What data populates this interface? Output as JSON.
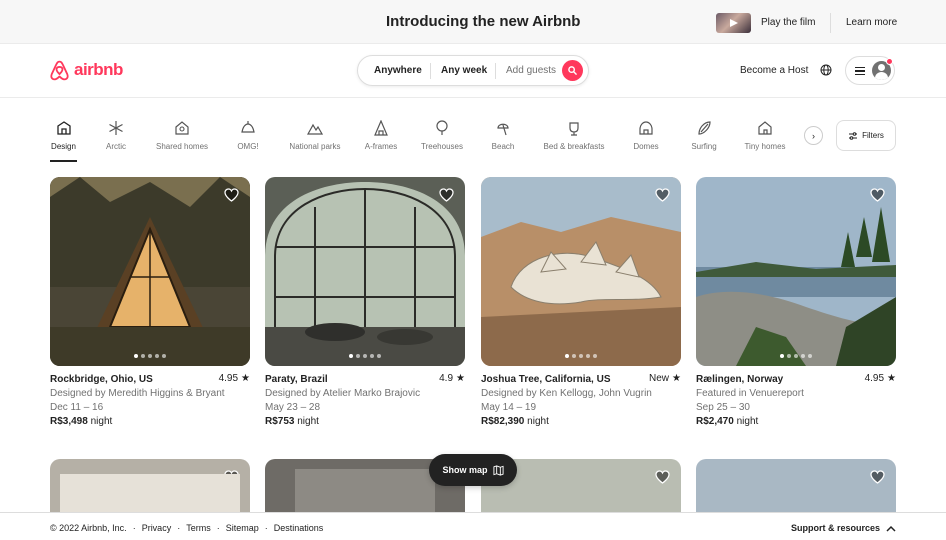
{
  "banner": {
    "title": "Introducing the new Airbnb",
    "play_label": "Play the film",
    "learn_label": "Learn more"
  },
  "header": {
    "logo_text": "airbnb",
    "brand_color": "#ff385c",
    "search": {
      "anywhere": "Anywhere",
      "any_week": "Any week",
      "add_guests": "Add guests"
    },
    "become_host": "Become a Host"
  },
  "categories": [
    {
      "label": "Design",
      "icon": "design-icon",
      "active": true
    },
    {
      "label": "Arctic",
      "icon": "arctic-icon"
    },
    {
      "label": "Shared homes",
      "icon": "shared-homes-icon"
    },
    {
      "label": "OMG!",
      "icon": "omg-icon"
    },
    {
      "label": "National parks",
      "icon": "national-parks-icon"
    },
    {
      "label": "A-frames",
      "icon": "a-frames-icon"
    },
    {
      "label": "Treehouses",
      "icon": "treehouses-icon"
    },
    {
      "label": "Beach",
      "icon": "beach-icon"
    },
    {
      "label": "Bed & breakfasts",
      "icon": "bed-breakfasts-icon"
    },
    {
      "label": "Domes",
      "icon": "domes-icon"
    },
    {
      "label": "Surfing",
      "icon": "surfing-icon"
    },
    {
      "label": "Tiny homes",
      "icon": "tiny-homes-icon"
    }
  ],
  "filters_label": "Filters",
  "listings": [
    {
      "location": "Rockbridge, Ohio, US",
      "rating": "4.95",
      "line1": "Designed by Meredith Higgins & Bryant",
      "dates": "Dec 11 – 16",
      "price": "R$3,498",
      "price_suffix": "night"
    },
    {
      "location": "Paraty, Brazil",
      "rating": "4.9",
      "line1": "Designed by Atelier Marko Brajovic",
      "dates": "May 23 – 28",
      "price": "R$753",
      "price_suffix": "night"
    },
    {
      "location": "Joshua Tree, California, US",
      "rating": "New",
      "line1": "Designed by Ken Kellogg, John Vugrin",
      "dates": "May 14 – 19",
      "price": "R$82,390",
      "price_suffix": "night"
    },
    {
      "location": "Rælingen, Norway",
      "rating": "4.95",
      "line1": "Featured in Venuereport",
      "dates": "Sep 25 – 30",
      "price": "R$2,470",
      "price_suffix": "night"
    }
  ],
  "show_map_label": "Show map",
  "footer": {
    "copyright": "© 2022 Airbnb, Inc.",
    "privacy": "Privacy",
    "terms": "Terms",
    "sitemap": "Sitemap",
    "destinations": "Destinations",
    "support": "Support & resources"
  }
}
